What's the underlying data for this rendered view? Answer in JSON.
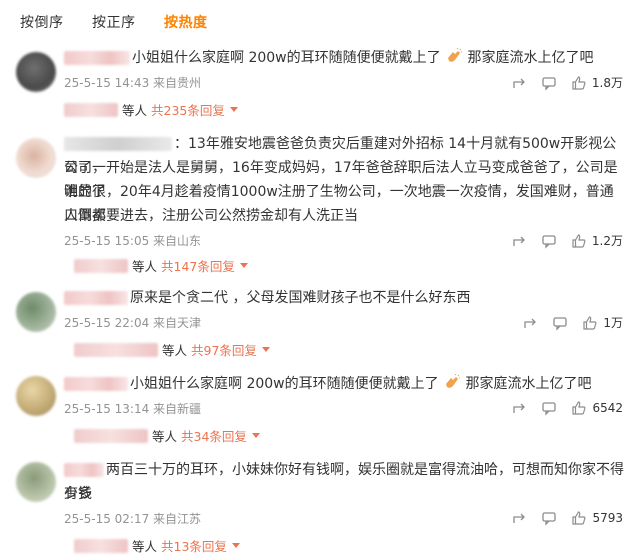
{
  "sort": {
    "desc_label": "按倒序",
    "asc_label": "按正序",
    "hot_label": "按热度"
  },
  "comments": [
    {
      "text_before": "小姐姐什么家庭啊 200w的耳环随随便便就戴上了",
      "text_after": "那家庭流水上亿了吧",
      "time": "25-5-15 14:43 来自贵州",
      "likes": "1.8万",
      "reply_prefix": "等人",
      "reply_label": "共235条回复"
    },
    {
      "line1": "：13年雅安地震爸爸负责灾后重建对外招标 14十月就有500w开影视公司了，",
      "line2": "公司一开始是法人是舅舅，16年变成妈妈，17年爸爸辞职后法人立马变成爸爸了，公司是谁的很",
      "line3": "明显了，20年4月趁着疫情1000w注册了生物公司，一次地震一次疫情，发国难财，普通人倒卖",
      "line4": "口罩都要进去，注册公司公然捞金却有人洗正当",
      "time": "25-5-15 15:05 来自山东",
      "likes": "1.2万",
      "reply_prefix": "等人",
      "reply_label": "共147条回复"
    },
    {
      "text": "原来是个贪二代 ，父母发国难财孩子也不是什么好东西",
      "time": "25-5-15 22:04 来自天津",
      "likes": "1万",
      "reply_prefix": "等人",
      "reply_label": "共97条回复"
    },
    {
      "text_before": "小姐姐什么家庭啊 200w的耳环随随便便就戴上了",
      "text_after": "那家庭流水上亿了吧",
      "time": "25-5-15 13:14 来自新疆",
      "likes": "6542",
      "reply_prefix": "等人",
      "reply_label": "共34条回复"
    },
    {
      "line1": "两百三十万的耳环，小妹妹你好有钱啊，娱乐圈就是富得流油哈，可想而知你家不得有多",
      "line2": "少钱",
      "time": "25-5-15 02:17 来自江苏",
      "likes": "5793",
      "reply_prefix": "等人",
      "reply_label": "共13条回复"
    }
  ],
  "icons": {
    "share": "share-icon",
    "comment": "comment-icon",
    "like": "like-icon",
    "emoji": "clapping-hands-emoji"
  },
  "colors": {
    "accent_orange": "#ff8200",
    "reply_link": "#eb7350",
    "meta_gray": "#939393"
  }
}
